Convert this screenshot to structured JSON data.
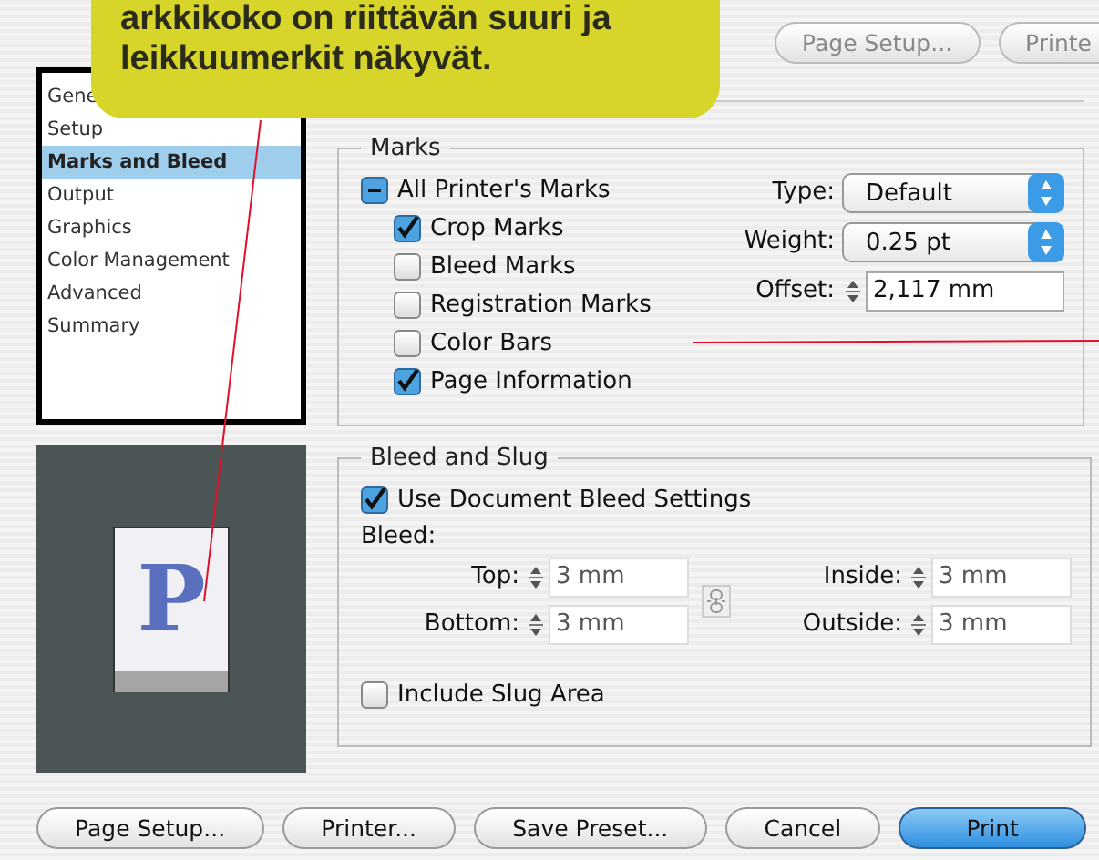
{
  "callout": {
    "lines": [
      "arkkikoko on riittävän suuri ja",
      "leikkuumerkit näkyvät."
    ]
  },
  "top_buttons": [
    {
      "label": "Page Setup..."
    },
    {
      "label": "Printe"
    }
  ],
  "sidebar": {
    "items": [
      {
        "label": "Gene",
        "selected": false
      },
      {
        "label": "Setup",
        "selected": false
      },
      {
        "label": "Marks and Bleed",
        "selected": true
      },
      {
        "label": "Output",
        "selected": false
      },
      {
        "label": "Graphics",
        "selected": false
      },
      {
        "label": "Color Management",
        "selected": false
      },
      {
        "label": "Advanced",
        "selected": false
      },
      {
        "label": "Summary",
        "selected": false
      }
    ]
  },
  "preview": {
    "glyph": "P"
  },
  "marks": {
    "title": "Marks",
    "all": {
      "label": "All Printer's Marks",
      "checked": true,
      "mixed": true
    },
    "items": [
      {
        "label": "Crop Marks",
        "checked": true
      },
      {
        "label": "Bleed Marks",
        "checked": false
      },
      {
        "label": "Registration Marks",
        "checked": false
      },
      {
        "label": "Color Bars",
        "checked": false
      },
      {
        "label": "Page Information",
        "checked": true
      }
    ],
    "fields": [
      {
        "kind": "popup",
        "label": "Type:",
        "value": "Default"
      },
      {
        "kind": "popup",
        "label": "Weight:",
        "value": "0.25 pt"
      },
      {
        "kind": "stepper",
        "label": "Offset:",
        "value": "2,117 mm"
      }
    ]
  },
  "bleed_and_slug": {
    "title": "Bleed and Slug",
    "use_document": {
      "label": "Use Document Bleed Settings",
      "checked": true
    },
    "bleed_label": "Bleed:",
    "fields": [
      {
        "label": "Top:",
        "value": "3 mm"
      },
      {
        "label": "Inside:",
        "value": "3 mm"
      },
      {
        "label": "Bottom:",
        "value": "3 mm"
      },
      {
        "label": "Outside:",
        "value": "3 mm"
      }
    ],
    "slug": {
      "label": "Include Slug Area",
      "checked": false
    }
  },
  "bottom_buttons": [
    {
      "label": "Page Setup...",
      "default": false
    },
    {
      "label": "Printer...",
      "default": false
    },
    {
      "label": "Save Preset...",
      "default": false
    },
    {
      "label": "Cancel",
      "default": false
    },
    {
      "label": "Print",
      "default": true
    }
  ]
}
